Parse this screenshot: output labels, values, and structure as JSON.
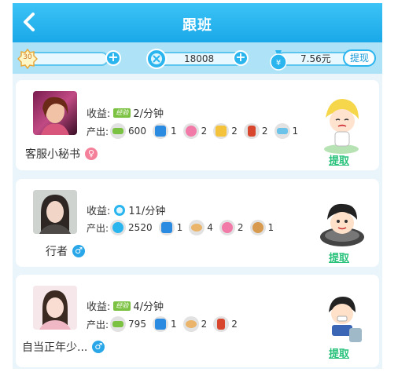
{
  "header": {
    "title": "跟班"
  },
  "resources": {
    "level": "30",
    "coins": "18008",
    "cash": "7.56元",
    "withdraw_label": "提现"
  },
  "cards": [
    {
      "earn_label": "收益:",
      "earn_badge": "经验",
      "earn_value": "2/分钟",
      "output_label": "产出:",
      "items": [
        {
          "icon": "exp-icon",
          "count": "600"
        },
        {
          "icon": "card-icon",
          "count": "1"
        },
        {
          "icon": "donut-icon",
          "count": "2"
        },
        {
          "icon": "fries-icon",
          "count": "2"
        },
        {
          "icon": "drink-icon",
          "count": "2"
        },
        {
          "icon": "ticket-icon",
          "count": "1"
        }
      ],
      "name": "客服小秘书",
      "gender": "♀",
      "action": "提取"
    },
    {
      "earn_label": "收益:",
      "earn_badge": "",
      "earn_value": "11/分钟",
      "output_label": "产出:",
      "items": [
        {
          "icon": "coin-icon",
          "count": "2520"
        },
        {
          "icon": "card-icon",
          "count": "1"
        },
        {
          "icon": "bread-icon",
          "count": "4"
        },
        {
          "icon": "donut-icon",
          "count": "2"
        },
        {
          "icon": "cookie-icon",
          "count": "1"
        }
      ],
      "name": "行者",
      "gender": "♂",
      "action": "提取"
    },
    {
      "earn_label": "收益:",
      "earn_badge": "经验",
      "earn_value": "4/分钟",
      "output_label": "产出:",
      "items": [
        {
          "icon": "exp-icon",
          "count": "795"
        },
        {
          "icon": "card-icon",
          "count": "1"
        },
        {
          "icon": "bread-icon",
          "count": "2"
        },
        {
          "icon": "drink-icon",
          "count": "2"
        }
      ],
      "name": "自当正年少...",
      "gender": "♂",
      "action": "提取"
    }
  ],
  "colors": {
    "header": "#1aa8e8",
    "accent_green": "#29c27b",
    "female": "#f4809a",
    "male": "#2aa7e8"
  }
}
